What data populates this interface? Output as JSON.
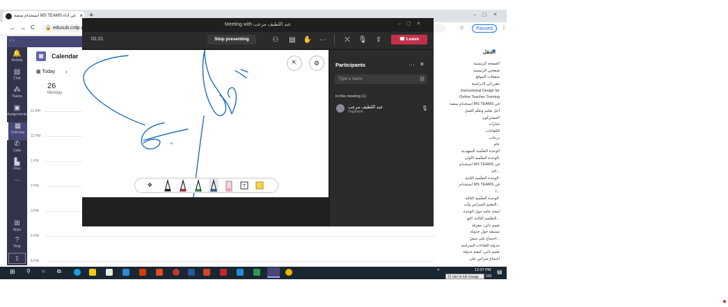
{
  "browser": {
    "tab_title": "استخدام منصة MS TEAMS في أداء...",
    "address": "edusub.crdp.o",
    "paused_label": "Paused"
  },
  "teams": {
    "app_bar": [
      {
        "label": "Activity",
        "icon": "bell-icon"
      },
      {
        "label": "Chat",
        "icon": "chat-icon"
      },
      {
        "label": "Teams",
        "icon": "teams-icon"
      },
      {
        "label": "Assignments",
        "icon": "assignments-icon"
      },
      {
        "label": "Calendar",
        "icon": "calendar-icon"
      },
      {
        "label": "Calls",
        "icon": "phone-icon"
      },
      {
        "label": "Files",
        "icon": "files-icon"
      }
    ],
    "apps_label": "Apps",
    "help_label": "Help",
    "calendar_title": "Calendar",
    "today_label": "Today",
    "day_number": "26",
    "day_name": "Monday",
    "hours": [
      "11 AM",
      "12 PM",
      "1 PM",
      "2 PM",
      "3 PM",
      "4 PM",
      "5 PM"
    ]
  },
  "meeting": {
    "window_title": "Meeting with عبد اللطيف مرعب",
    "timer": "01:21",
    "stop_presenting": "Stop presenting",
    "leave": "Leave",
    "participants_title": "Participants",
    "type_name_placeholder": "Type a name",
    "in_meeting": "In this meeting (1)",
    "participant_name": "عبد اللطيف مرعب",
    "participant_role": "Organizer"
  },
  "lms": {
    "nav_title": "التنقل",
    "items": [
      "الصفحة الرئيسية",
      "صفحتي الرئيسية",
      "صفحات الموقع",
      "مقرراتي الدراسية",
      "Instructional Design for",
      "Online Teacher Training",
      "استخدام منصة MS TEAMS في",
      "أجل تعليم وتعلّم أفضل",
      "المشتركون",
      "شارات",
      "الكفاءات",
      "درجات",
      "عام",
      "الوحدة التعلّمية التمهيدية",
      "الوحدة التعلّمية الأولى:",
      "استخدام MS TEAMS في",
      "التد...",
      "الوحدة التعلّمية الثانية:",
      "استخدام MS TEAMS في",
      "ا...",
      "الوحدة التعلّمية الثالثة:",
      "التعليم المتزامن وأت...",
      "لمحة عامة حول الوحدة",
      "التعلّمية الثالثة: التع...",
      "تقييم ذاتي: معرفة",
      "مسبقة حول جدولة",
      "اجتماع على منصّ...",
      "جدولة اللقاءات المتزامنة",
      "تقييم ذاتي: كيفية جدولة",
      "اجتماع متزامن على"
    ]
  },
  "taskbar": {
    "time": "12:07 PM",
    "tooltip": "31 min to full charge",
    "year_fragment": "020"
  },
  "colors": {
    "teams_purple": "#464775",
    "app_bar": "#33344a",
    "leave_red": "#c4314b",
    "ink_blue": "#1e6fb8"
  }
}
